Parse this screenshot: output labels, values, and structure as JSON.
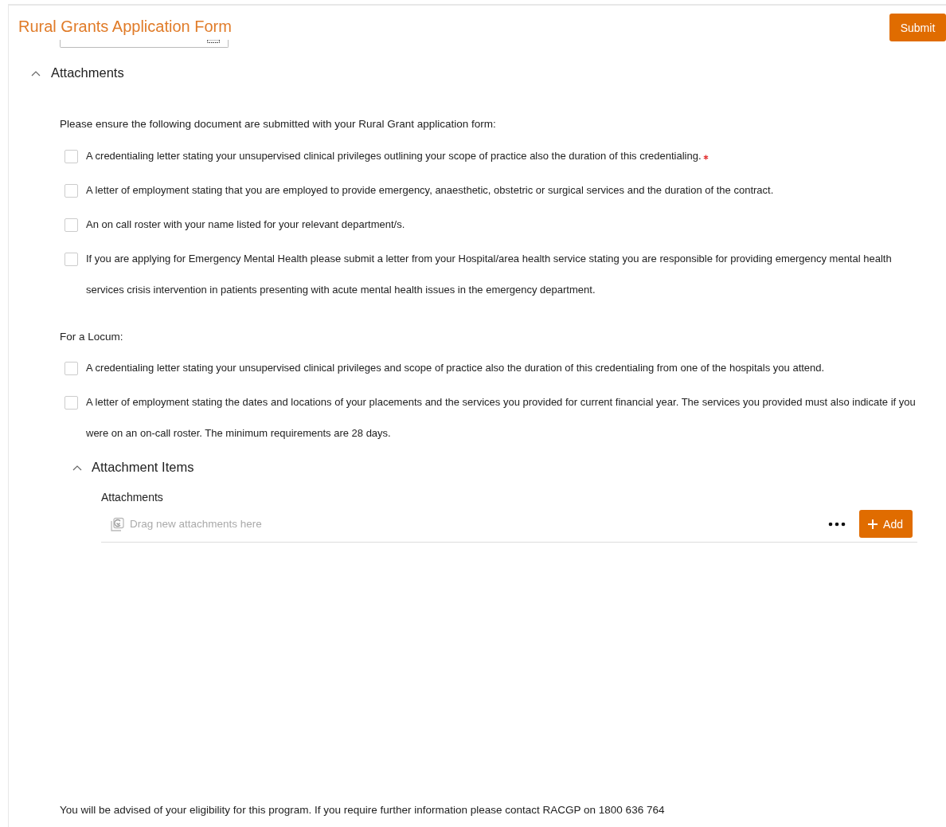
{
  "header": {
    "title": "Rural Grants Application Form",
    "submit_label": "Submit"
  },
  "section": {
    "title": "Attachments",
    "expanded": true,
    "intro": "Please ensure the following document are submitted with your Rural Grant application form:",
    "items": [
      {
        "text": "A credentialing letter stating your unsupervised clinical privileges outlining your scope of practice also the duration of this credentialing.",
        "checked": false,
        "required": true
      },
      {
        "text": "A letter of employment stating that you are employed to provide emergency, anaesthetic, obstetric or surgical services and the duration of the contract.",
        "checked": false,
        "required": false
      },
      {
        "text": "An on call roster with your name listed for your relevant department/s.",
        "checked": false,
        "required": false
      },
      {
        "text": "If you are applying for Emergency Mental Health please submit a letter from your Hospital/area health service stating you are responsible for providing emergency mental health services crisis intervention in patients presenting with acute mental health issues in the emergency department.",
        "checked": false,
        "required": false
      }
    ],
    "locum_label": "For a Locum:",
    "locum_items": [
      {
        "text": "A credentialing letter stating your unsupervised clinical privileges and scope of practice also the duration of this credentialing from one of the hospitals you attend.",
        "checked": false,
        "required": false
      },
      {
        "text": "A letter of employment stating the dates and locations of your placements and the services you provided for current financial year. The services you provided must also indicate if you were on an on-call roster. The minimum requirements are 28 days.",
        "checked": false,
        "required": false
      }
    ],
    "subsection": {
      "title": "Attachment Items",
      "expanded": true,
      "label": "Attachments",
      "drop_placeholder": "Drag new attachments here",
      "add_label": "Add"
    }
  },
  "footer": "You will be advised of your eligibility for this program. If you require further information please contact RACGP on 1800 636 764"
}
